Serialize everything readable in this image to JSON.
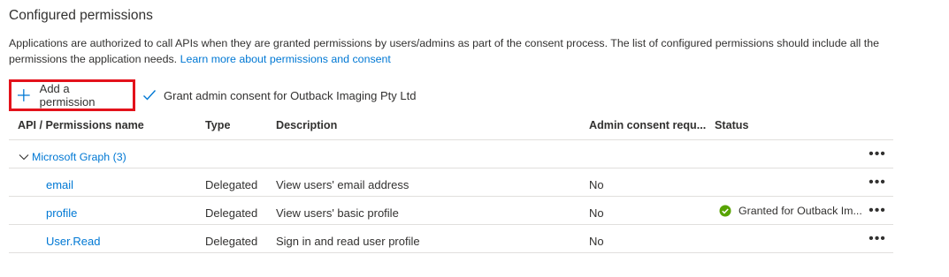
{
  "section": {
    "title": "Configured permissions",
    "description": "Applications are authorized to call APIs when they are granted permissions by users/admins as part of the consent process. The list of configured permissions should include all the permissions the application needs.",
    "learn_more_link": "Learn more about permissions and consent"
  },
  "toolbar": {
    "add_permission_label": "Add a permission",
    "add_permission_icon": "plus-icon",
    "grant_consent_label": "Grant admin consent for Outback Imaging Pty Ltd",
    "grant_consent_icon": "checkmark-icon",
    "highlight_color": "#e3121b"
  },
  "table": {
    "columns": {
      "name": "API / Permissions name",
      "type": "Type",
      "description": "Description",
      "admin_consent": "Admin consent requ...",
      "status": "Status"
    },
    "group": {
      "label": "Microsoft Graph (3)",
      "icon": "chevron-down-icon"
    },
    "rows": [
      {
        "name": "email",
        "type": "Delegated",
        "description": "View users' email address",
        "admin_consent": "No",
        "status": ""
      },
      {
        "name": "profile",
        "type": "Delegated",
        "description": "View users' basic profile",
        "admin_consent": "No",
        "status": "Granted for Outback Im..."
      },
      {
        "name": "User.Read",
        "type": "Delegated",
        "description": "Sign in and read user profile",
        "admin_consent": "No",
        "status": ""
      }
    ],
    "more_label": "•••"
  },
  "colors": {
    "link": "#0078d4",
    "granted": "#57a300",
    "border": "#e1dfdd"
  }
}
